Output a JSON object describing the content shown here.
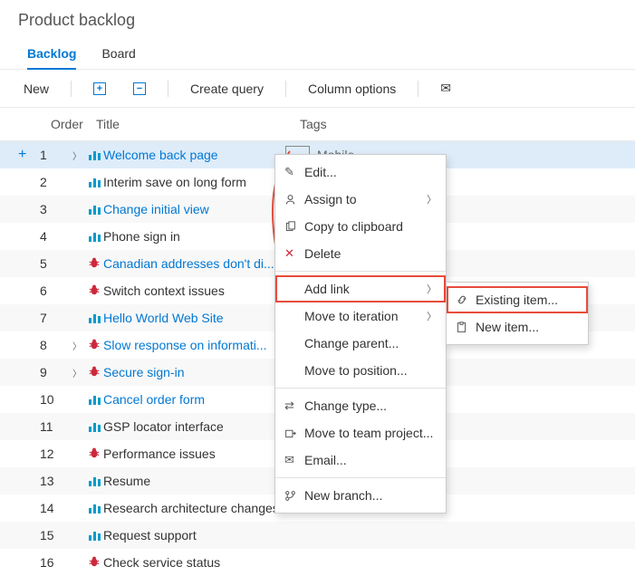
{
  "page": {
    "title": "Product backlog"
  },
  "tabs": {
    "backlog": "Backlog",
    "board": "Board"
  },
  "toolbar": {
    "new": "New",
    "create_query": "Create query",
    "column_options": "Column options"
  },
  "columns": {
    "order": "Order",
    "title": "Title",
    "tags": "Tags"
  },
  "tag_mobile": "Mobile",
  "items": [
    {
      "order": "1",
      "type": "pbi",
      "title": "Welcome back page",
      "link": true,
      "expandable": true,
      "selected": true,
      "tag": "Mobile"
    },
    {
      "order": "2",
      "type": "pbi",
      "title": "Interim save on long form",
      "link": false
    },
    {
      "order": "3",
      "type": "pbi",
      "title": "Change initial view",
      "link": true
    },
    {
      "order": "4",
      "type": "pbi",
      "title": "Phone sign in",
      "link": false
    },
    {
      "order": "5",
      "type": "bug",
      "title": "Canadian addresses don't di...",
      "link": true
    },
    {
      "order": "6",
      "type": "bug",
      "title": "Switch context issues",
      "link": false
    },
    {
      "order": "7",
      "type": "pbi",
      "title": "Hello World Web Site",
      "link": true
    },
    {
      "order": "8",
      "type": "bug",
      "title": "Slow response on informati...",
      "link": true,
      "expandable": true
    },
    {
      "order": "9",
      "type": "bug",
      "title": "Secure sign-in",
      "link": true,
      "expandable": true
    },
    {
      "order": "10",
      "type": "pbi",
      "title": "Cancel order form",
      "link": true
    },
    {
      "order": "11",
      "type": "pbi",
      "title": "GSP locator interface",
      "link": false
    },
    {
      "order": "12",
      "type": "bug",
      "title": "Performance issues",
      "link": false
    },
    {
      "order": "13",
      "type": "pbi",
      "title": "Resume",
      "link": false
    },
    {
      "order": "14",
      "type": "pbi",
      "title": "Research architecture changes",
      "link": false
    },
    {
      "order": "15",
      "type": "pbi",
      "title": "Request support",
      "link": false
    },
    {
      "order": "16",
      "type": "bug",
      "title": "Check service status",
      "link": false
    }
  ],
  "context_menu": {
    "edit": "Edit...",
    "assign_to": "Assign to",
    "copy": "Copy to clipboard",
    "delete": "Delete",
    "add_link": "Add link",
    "move_iteration": "Move to iteration",
    "change_parent": "Change parent...",
    "move_position": "Move to position...",
    "change_type": "Change type...",
    "move_team": "Move to team project...",
    "email": "Email...",
    "new_branch": "New branch..."
  },
  "submenu": {
    "existing": "Existing item...",
    "new": "New item..."
  }
}
